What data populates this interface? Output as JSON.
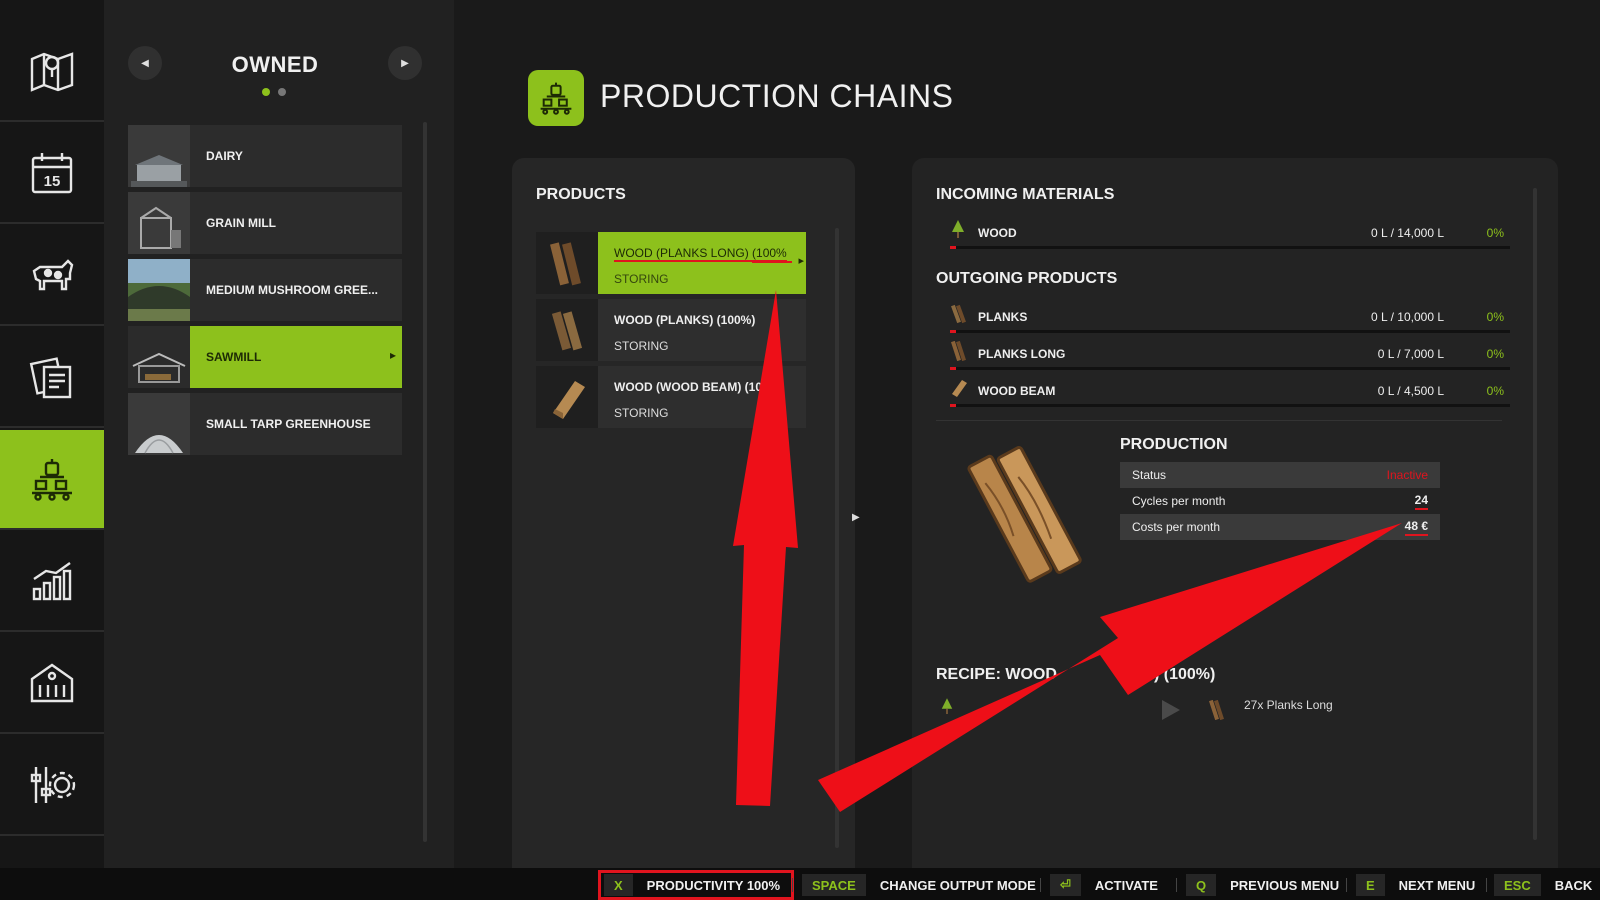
{
  "left_nav": {
    "items": [
      {
        "icon": "map-icon"
      },
      {
        "icon": "calendar-icon",
        "day": "15"
      },
      {
        "icon": "cow-icon"
      },
      {
        "icon": "contracts-icon"
      },
      {
        "icon": "production-icon"
      },
      {
        "icon": "statistics-icon"
      },
      {
        "icon": "farm-building-icon"
      },
      {
        "icon": "settings-icon"
      }
    ],
    "active_index": 4
  },
  "owned": {
    "title": "OWNED",
    "page_count": 2,
    "current_page": 1,
    "items": [
      {
        "label": "DAIRY"
      },
      {
        "label": "GRAIN MILL"
      },
      {
        "label": "MEDIUM MUSHROOM GREE..."
      },
      {
        "label": "SAWMILL"
      },
      {
        "label": "SMALL TARP GREENHOUSE"
      }
    ],
    "selected_index": 3
  },
  "header": {
    "title": "PRODUCTION CHAINS"
  },
  "products": {
    "heading": "PRODUCTS",
    "items": [
      {
        "name": "WOOD (PLANKS LONG) (100%",
        "state": "STORING"
      },
      {
        "name": "WOOD (PLANKS) (100%)",
        "state": "STORING"
      },
      {
        "name": "WOOD (WOOD BEAM) (100%)",
        "state": "STORING"
      }
    ],
    "selected_index": 0
  },
  "incoming": {
    "heading": "INCOMING MATERIALS",
    "items": [
      {
        "name": "WOOD",
        "amount": "0 L / 14,000 L",
        "percent": "0%"
      }
    ]
  },
  "outgoing": {
    "heading": "OUTGOING PRODUCTS",
    "items": [
      {
        "name": "PLANKS",
        "amount": "0 L / 10,000 L",
        "percent": "0%"
      },
      {
        "name": "PLANKS LONG",
        "amount": "0 L / 7,000 L",
        "percent": "0%"
      },
      {
        "name": "WOOD BEAM",
        "amount": "0 L / 4,500 L",
        "percent": "0%"
      }
    ]
  },
  "production": {
    "heading": "PRODUCTION",
    "rows": [
      {
        "label": "Status",
        "value": "Inactive"
      },
      {
        "label": "Cycles per month",
        "value": "24"
      },
      {
        "label": "Costs per month",
        "value": "48 €"
      }
    ]
  },
  "recipe": {
    "heading_left": "RECIPE: WOOD",
    "heading_right": "NG) (100%)",
    "output": "27x Planks Long"
  },
  "bottom_bar": {
    "hints": [
      {
        "key": "X",
        "label": "PRODUCTIVITY 100%"
      },
      {
        "key": "SPACE",
        "label": "CHANGE OUTPUT MODE"
      },
      {
        "key": "⏎",
        "label": "ACTIVATE"
      },
      {
        "key": "Q",
        "label": "PREVIOUS MENU"
      },
      {
        "key": "E",
        "label": "NEXT MENU"
      },
      {
        "key": "ESC",
        "label": "BACK"
      }
    ]
  },
  "colors": {
    "accent": "#8dc11c",
    "annotation_red": "#e0141e",
    "background": "#1a1a1a",
    "panel": "#262626"
  }
}
